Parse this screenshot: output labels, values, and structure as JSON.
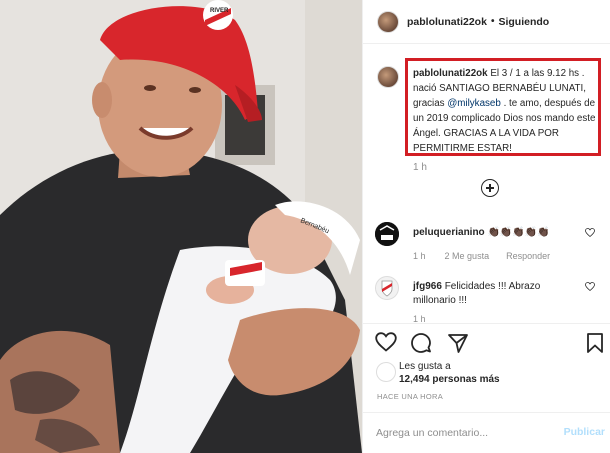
{
  "header": {
    "username": "pablolunati22ok",
    "separator": "•",
    "follow_status": "Siguiendo"
  },
  "caption": {
    "username": "pablolunati22ok",
    "text_before_mention": "El 3 / 1 a las 9.12 hs . nació SANTIAGO BERNABÉU LUNATI, gracias",
    "mention": "@milykaseb",
    "text_after_mention": ". te amo, después de un 2019 complicado Dios nos mando este Ángel. GRACIAS A LA VIDA POR PERMITIRME ESTAR!",
    "time": "1 h"
  },
  "comments": [
    {
      "username": "peluquerianino",
      "text": "👏🏿👏🏿👏🏿👏🏿👏🏿",
      "time": "1 h",
      "likes": "2 Me gusta",
      "reply": "Responder"
    },
    {
      "username": "jfg966",
      "text": "Felicidades !!! Abrazo millonario !!!",
      "time": "1 h"
    }
  ],
  "likes": {
    "prefix": "Les gusta a",
    "count": "12,494 personas más"
  },
  "timestamp": "HACE UNA HORA",
  "comment_box": {
    "placeholder": "Agrega un comentario...",
    "publish": "Publicar"
  },
  "photo": {
    "cap_text": "RIVER",
    "baby_hat_text": "Bernabéu"
  },
  "colors": {
    "highlight_border": "#d21e24",
    "link": "#003569",
    "publish_disabled": "#b2dffc",
    "muted": "#8e8e8e"
  }
}
